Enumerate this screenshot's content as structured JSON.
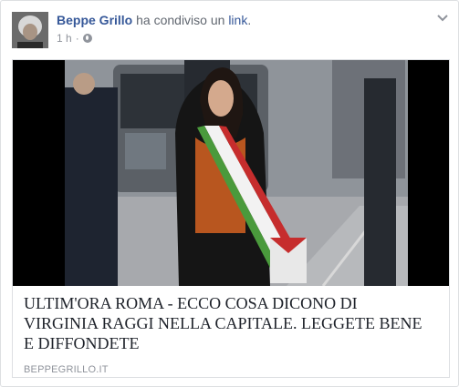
{
  "post": {
    "author": "Beppe Grillo",
    "action_text": " ha condiviso un ",
    "action_link": "link",
    "action_end": ".",
    "time": "1 h",
    "separator": "·",
    "privacy_icon": "globe-icon",
    "menu_icon": "chevron-down-icon"
  },
  "shared_link": {
    "title": "ULTIM'ORA ROMA - ECCO COSA DICONO DI VIRGINIA RAGGI NELLA CAPITALE. LEGGETE BENE E DIFFONDETE",
    "domain": "BEPPEGRILLO.IT"
  }
}
